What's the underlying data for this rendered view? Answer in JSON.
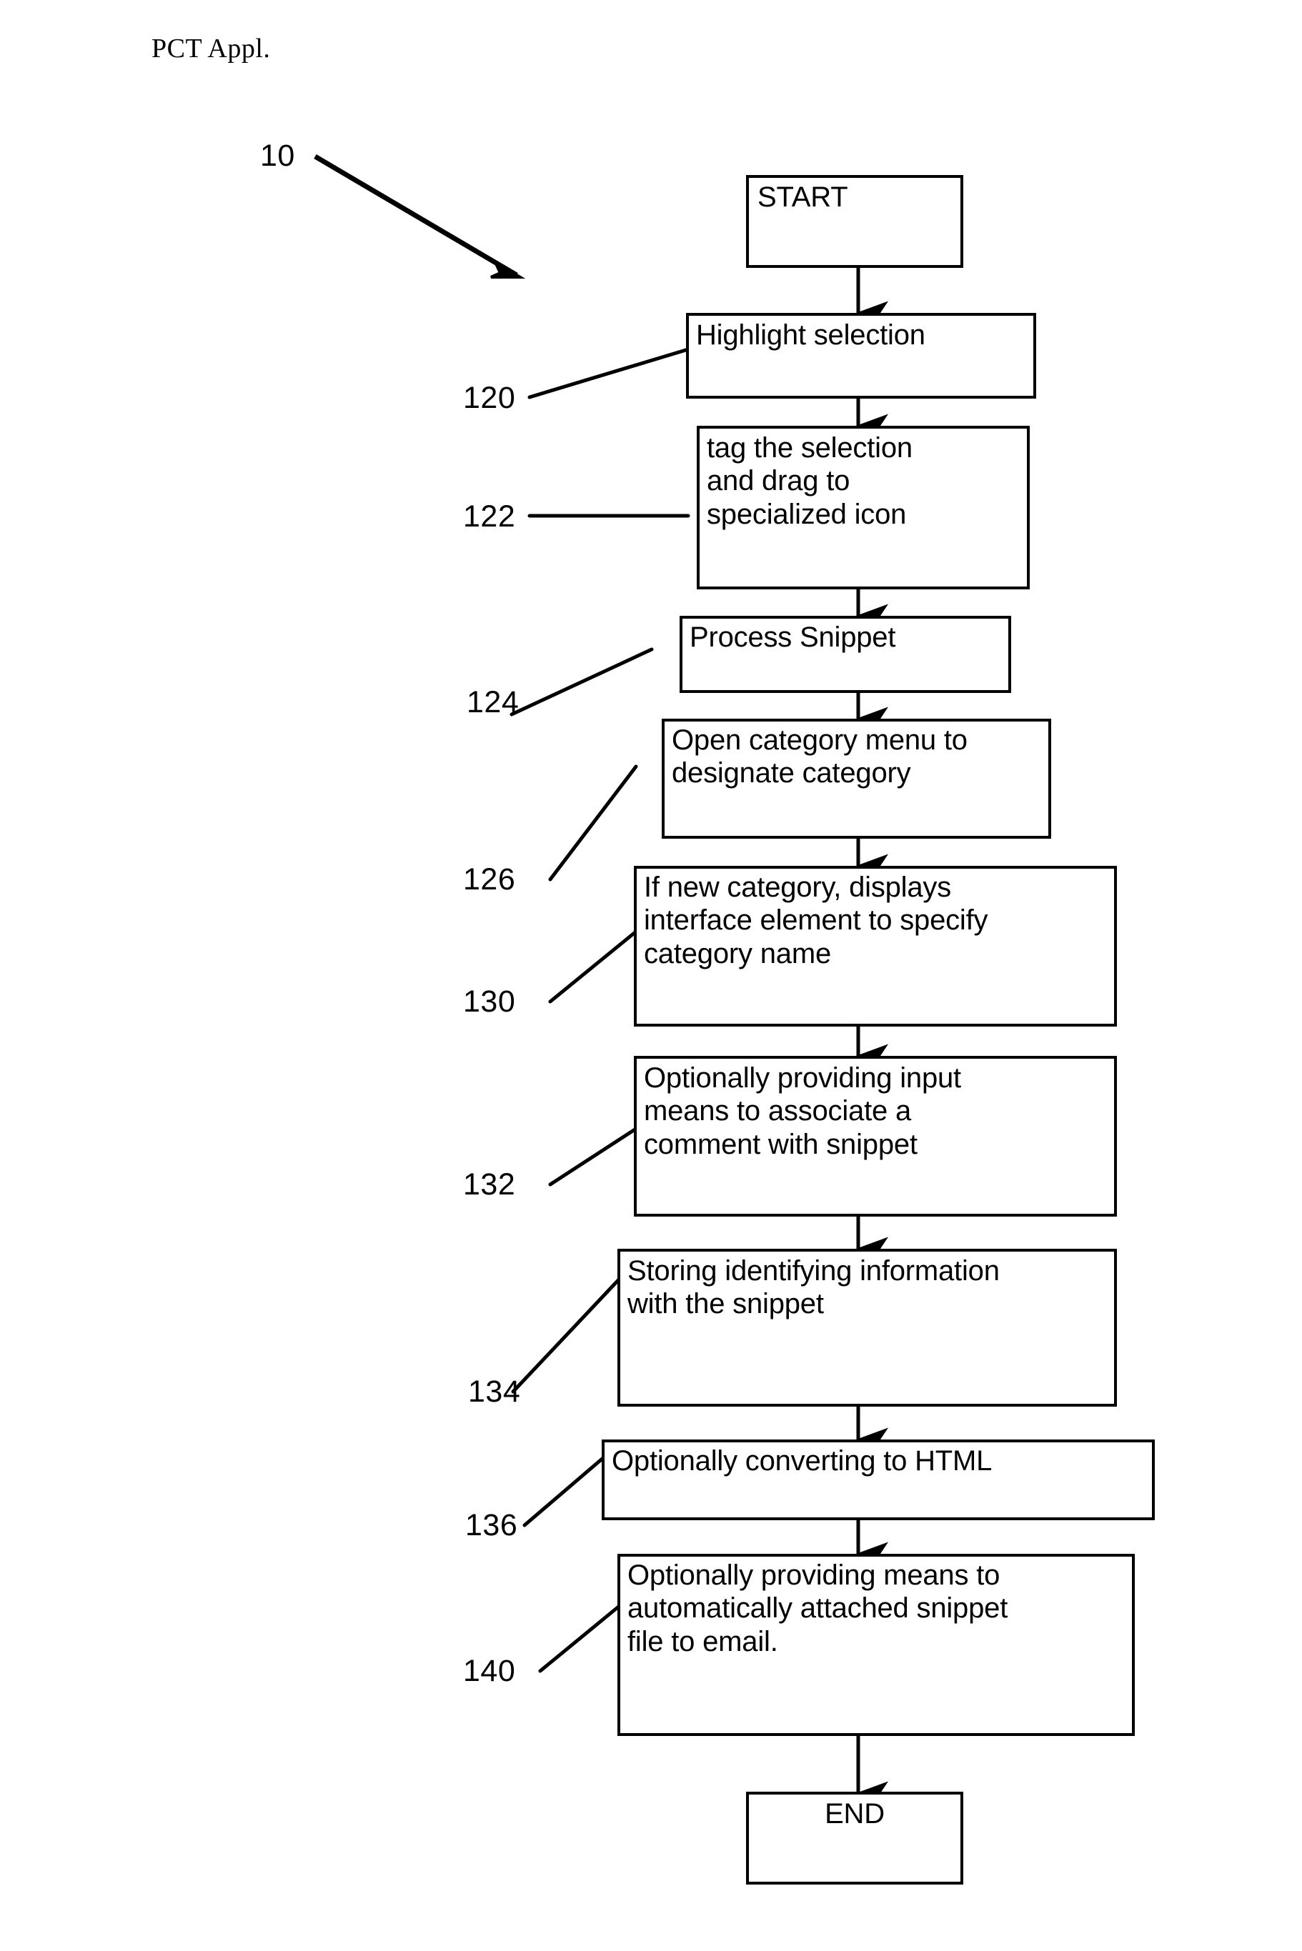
{
  "document": {
    "header": "PCT Appl."
  },
  "figure": {
    "main_reference": "10",
    "nodes": [
      {
        "id": "start",
        "label": "START",
        "align": "left"
      },
      {
        "id": "s120",
        "label": "Highlight selection",
        "align": "left"
      },
      {
        "id": "s122",
        "label": "tag the selection\nand drag to\nspecialized icon",
        "align": "left"
      },
      {
        "id": "s124",
        "label": "Process Snippet",
        "align": "left"
      },
      {
        "id": "s126",
        "label": "Open category menu to\ndesignate category",
        "align": "left"
      },
      {
        "id": "s130",
        "label": "If new category, displays\ninterface element to specify\ncategory name",
        "align": "left"
      },
      {
        "id": "s132",
        "label": "Optionally providing input\nmeans to associate a\ncomment with snippet",
        "align": "left"
      },
      {
        "id": "s134",
        "label": "Storing identifying information\nwith the snippet",
        "align": "left"
      },
      {
        "id": "s136",
        "label": "Optionally converting to HTML",
        "align": "left"
      },
      {
        "id": "s140",
        "label": "Optionally providing means to\nautomatically attached snippet\nfile to email.",
        "align": "left"
      },
      {
        "id": "end",
        "label": "END",
        "align": "center"
      }
    ],
    "reference_numerals": [
      {
        "id": "ref120",
        "label": "120"
      },
      {
        "id": "ref122",
        "label": "122"
      },
      {
        "id": "ref124",
        "label": "124"
      },
      {
        "id": "ref126",
        "label": "126"
      },
      {
        "id": "ref130",
        "label": "130"
      },
      {
        "id": "ref132",
        "label": "132"
      },
      {
        "id": "ref134",
        "label": "134"
      },
      {
        "id": "ref136",
        "label": "136"
      },
      {
        "id": "ref140",
        "label": "140"
      }
    ]
  },
  "colors": {
    "ink": "#000000",
    "paper": "#ffffff"
  }
}
